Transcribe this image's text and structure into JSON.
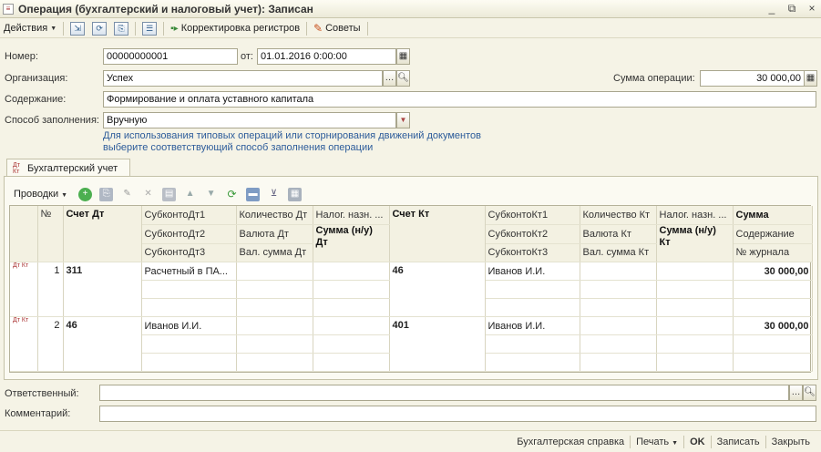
{
  "window": {
    "title": "Операция (бухгалтерский и налоговый учет): Записан",
    "controls": [
      "_",
      "⧉",
      "×"
    ]
  },
  "toolbar": {
    "actions_label": "Действия",
    "corrections_label": "Корректировка регистров",
    "tips_label": "Советы"
  },
  "form": {
    "number_label": "Номер:",
    "number_value": "00000000001",
    "date_label": "от:",
    "date_value": "01.01.2016 0:00:00",
    "org_label": "Организация:",
    "org_value": "Успех",
    "sum_label": "Сумма операции:",
    "sum_value": "30 000,00",
    "content_label": "Содержание:",
    "content_value": "Формирование и оплата уставного капитала",
    "fill_label": "Способ заполнения:",
    "fill_value": "Вручную",
    "hint_line1": "Для использования типовых операций или сторнирования движений документов",
    "hint_line2": "выберите соответствующий способ заполнения операции"
  },
  "tab": {
    "label": "Бухгалтерский учет",
    "icon_text": "Дт Кт"
  },
  "postings": {
    "toolbar_label": "Проводки",
    "headers": {
      "num": "№",
      "acc_dt": "Счет Дт",
      "sub_dt1": "СубконтоДт1",
      "sub_dt2": "СубконтоДт2",
      "sub_dt3": "СубконтоДт3",
      "qty_dt": "Количество Дт",
      "cur_dt": "Валюта Дт",
      "cur_sum_dt": "Вал. сумма Дт",
      "tax_dt": "Налог. назн. ...",
      "tax_sum_dt": "Сумма (н/у) Дт",
      "acc_kt": "Счет Кт",
      "sub_kt1": "СубконтоКт1",
      "sub_kt2": "СубконтоКт2",
      "sub_kt3": "СубконтоКт3",
      "qty_kt": "Количество Кт",
      "cur_kt": "Валюта Кт",
      "cur_sum_kt": "Вал. сумма Кт",
      "tax_kt": "Налог. назн. ...",
      "tax_sum_kt": "Сумма (н/у) Кт",
      "sum": "Сумма",
      "content": "Содержание",
      "journal": "№ журнала"
    },
    "rows": [
      {
        "num": "1",
        "acc_dt": "311",
        "sub_dt1": "Расчетный в ПА...",
        "acc_kt": "46",
        "sub_kt1": "Иванов И.И.",
        "sum": "30 000,00"
      },
      {
        "num": "2",
        "acc_dt": "46",
        "sub_dt1": "Иванов И.И.",
        "acc_kt": "401",
        "sub_kt1": "Иванов И.И.",
        "sum": "30 000,00"
      }
    ]
  },
  "bottom": {
    "responsible_label": "Ответственный:",
    "responsible_value": "",
    "comment_label": "Комментарий:",
    "comment_value": ""
  },
  "footer": {
    "report_label": "Бухгалтерская справка",
    "print_label": "Печать",
    "ok_label": "OK",
    "save_label": "Записать",
    "close_label": "Закрыть"
  }
}
